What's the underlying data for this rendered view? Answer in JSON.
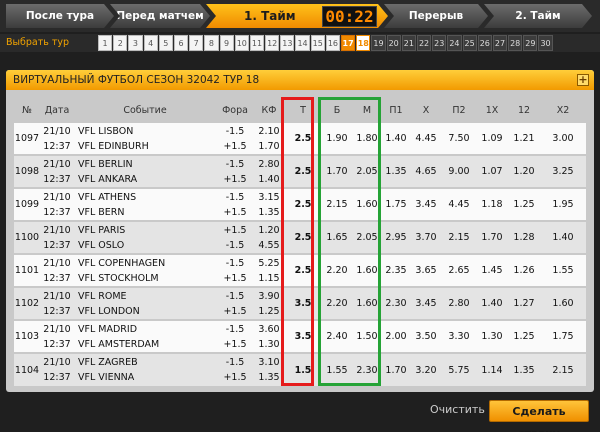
{
  "stages": {
    "after_tour": "После тура",
    "before_match": "Перед матчем",
    "first_half": "1. Тайм",
    "timer": "00:22",
    "break": "Перерыв",
    "second_half": "2. Тайм"
  },
  "tour_select": {
    "label": "Выбрать тур",
    "tours": [
      "1",
      "2",
      "3",
      "4",
      "5",
      "6",
      "7",
      "8",
      "9",
      "10",
      "11",
      "12",
      "13",
      "14",
      "15",
      "16",
      "17",
      "18",
      "19",
      "20",
      "21",
      "22",
      "23",
      "24",
      "25",
      "26",
      "27",
      "28",
      "29",
      "30"
    ],
    "current": "17",
    "selected": "18"
  },
  "panel": {
    "title": "ВИРТУАЛЬНЫЙ ФУТБОЛ СЕЗОН 32042 ТУР 18",
    "expand_icon": "+"
  },
  "table": {
    "headers": [
      "№",
      "Дата",
      "Событие",
      "Фора",
      "КФ",
      "Т",
      "Б",
      "М",
      "П1",
      "X",
      "П2",
      "1X",
      "12",
      "X2"
    ],
    "rows": [
      {
        "no": "1097",
        "date": "21/10",
        "time": "12:37",
        "team1": "VFL LISBON",
        "team2": "VFL EDINBURH",
        "fora1": "-1.5",
        "fora2": "+1.5",
        "kf1": "2.10",
        "kf2": "1.70",
        "t": "2.5",
        "b": "1.90",
        "m": "1.80",
        "p1": "1.40",
        "x": "4.45",
        "p2": "7.50",
        "x1": "1.09",
        "x12": "1.21",
        "x2": "3.00"
      },
      {
        "no": "1098",
        "date": "21/10",
        "time": "12:37",
        "team1": "VFL BERLIN",
        "team2": "VFL ANKARA",
        "fora1": "-1.5",
        "fora2": "+1.5",
        "kf1": "2.80",
        "kf2": "1.40",
        "t": "2.5",
        "b": "1.70",
        "m": "2.05",
        "p1": "1.35",
        "x": "4.65",
        "p2": "9.00",
        "x1": "1.07",
        "x12": "1.20",
        "x2": "3.25"
      },
      {
        "no": "1099",
        "date": "21/10",
        "time": "12:37",
        "team1": "VFL ATHENS",
        "team2": "VFL BERN",
        "fora1": "-1.5",
        "fora2": "+1.5",
        "kf1": "3.15",
        "kf2": "1.35",
        "t": "2.5",
        "b": "2.15",
        "m": "1.60",
        "p1": "1.75",
        "x": "3.45",
        "p2": "4.45",
        "x1": "1.18",
        "x12": "1.25",
        "x2": "1.95"
      },
      {
        "no": "1100",
        "date": "21/10",
        "time": "12:37",
        "team1": "VFL PARIS",
        "team2": "VFL OSLO",
        "fora1": "+1.5",
        "fora2": "-1.5",
        "kf1": "1.20",
        "kf2": "4.55",
        "t": "2.5",
        "b": "1.65",
        "m": "2.05",
        "p1": "2.95",
        "x": "3.70",
        "p2": "2.15",
        "x1": "1.70",
        "x12": "1.28",
        "x2": "1.40"
      },
      {
        "no": "1101",
        "date": "21/10",
        "time": "12:37",
        "team1": "VFL COPENHAGEN",
        "team2": "VFL STOCKHOLM",
        "fora1": "-1.5",
        "fora2": "+1.5",
        "kf1": "5.25",
        "kf2": "1.15",
        "t": "2.5",
        "b": "2.20",
        "m": "1.60",
        "p1": "2.35",
        "x": "3.65",
        "p2": "2.65",
        "x1": "1.45",
        "x12": "1.26",
        "x2": "1.55"
      },
      {
        "no": "1102",
        "date": "21/10",
        "time": "12:37",
        "team1": "VFL ROME",
        "team2": "VFL LONDON",
        "fora1": "-1.5",
        "fora2": "+1.5",
        "kf1": "3.90",
        "kf2": "1.25",
        "t": "3.5",
        "b": "2.20",
        "m": "1.60",
        "p1": "2.30",
        "x": "3.45",
        "p2": "2.80",
        "x1": "1.40",
        "x12": "1.27",
        "x2": "1.60"
      },
      {
        "no": "1103",
        "date": "21/10",
        "time": "12:37",
        "team1": "VFL MADRID",
        "team2": "VFL AMSTERDAM",
        "fora1": "-1.5",
        "fora2": "+1.5",
        "kf1": "3.60",
        "kf2": "1.30",
        "t": "3.5",
        "b": "2.40",
        "m": "1.50",
        "p1": "2.00",
        "x": "3.50",
        "p2": "3.30",
        "x1": "1.30",
        "x12": "1.25",
        "x2": "1.75"
      },
      {
        "no": "1104",
        "date": "21/10",
        "time": "12:37",
        "team1": "VFL ZAGREB",
        "team2": "VFL VIENNA",
        "fora1": "-1.5",
        "fora2": "+1.5",
        "kf1": "3.10",
        "kf2": "1.35",
        "t": "1.5",
        "b": "1.55",
        "m": "2.30",
        "p1": "1.70",
        "x": "3.20",
        "p2": "5.75",
        "x1": "1.14",
        "x12": "1.35",
        "x2": "2.15"
      }
    ]
  },
  "footer": {
    "clear": "Очистить",
    "place_bet": "Сделать ставку"
  },
  "colors": {
    "accent": "#f08a00",
    "highlight_red": "#e51b1b",
    "highlight_green": "#25a336"
  }
}
